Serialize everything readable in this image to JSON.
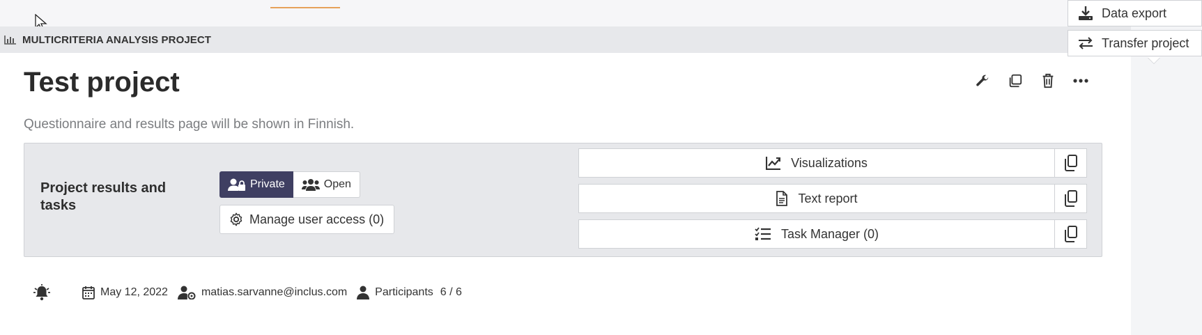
{
  "project_type": {
    "label": "MULTICRITERIA ANALYSIS PROJECT",
    "icon": "bar-chart-icon"
  },
  "project": {
    "title": "Test project",
    "language_note": "Questionnaire and results page will be shown in Finnish."
  },
  "toolbar": {
    "icons": [
      "wrench-icon",
      "duplicate-icon",
      "trash-icon",
      "more-icon"
    ]
  },
  "results": {
    "title": "Project results and tasks",
    "privacy": {
      "options": [
        {
          "label": "Private",
          "icon": "user-lock-icon",
          "selected": true
        },
        {
          "label": "Open",
          "icon": "users-icon",
          "selected": false
        }
      ]
    },
    "manage_access_label": "Manage user access (0)",
    "links": [
      {
        "label": "Visualizations",
        "icon": "chart-line-icon"
      },
      {
        "label": "Text report",
        "icon": "document-icon"
      },
      {
        "label": "Task Manager (0)",
        "icon": "task-list-icon"
      }
    ]
  },
  "meta": {
    "date": "May 12, 2022",
    "owner": "matias.sarvanne@inclus.com",
    "participants_label": "Participants",
    "participants_count": "6 / 6"
  },
  "more_menu": {
    "items": [
      {
        "label": "Data export",
        "icon": "download-icon"
      },
      {
        "label": "Transfer project",
        "icon": "transfer-icon"
      }
    ]
  },
  "colors": {
    "accent_dark": "#3f3f62",
    "tab_underline": "#e6a15a",
    "panel_bg": "#e7e8eb"
  }
}
